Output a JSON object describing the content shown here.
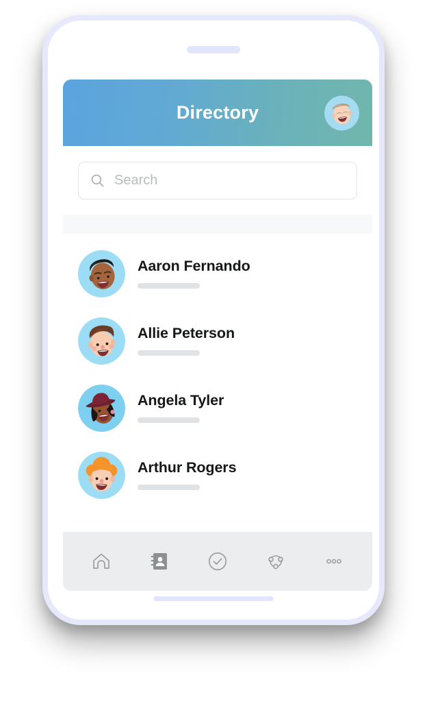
{
  "device": {
    "speaker_name": "speaker-grille",
    "home_indicator_name": "home-indicator",
    "frame_color": "#e6e8fb"
  },
  "header": {
    "title": "Directory",
    "gradient_from": "#5ba4de",
    "gradient_to": "#71b6ac",
    "avatar": {
      "name": "header-profile-avatar",
      "skin": "#f2d0b8",
      "hair": "#b49a82",
      "bg": "#a5dcf2"
    }
  },
  "search": {
    "placeholder": "Search",
    "value": "",
    "icon": "search-icon"
  },
  "contacts": [
    {
      "name": "Aaron Fernando",
      "avatar": {
        "skin": "#a4653c",
        "hair": "#1b1b1b",
        "bg": "#9ddcf5"
      }
    },
    {
      "name": "Allie Peterson",
      "avatar": {
        "skin": "#f7cdb2",
        "hair": "#6d3b24",
        "bg": "#9ddcf5"
      }
    },
    {
      "name": "Angela Tyler",
      "avatar": {
        "skin": "#97522f",
        "hair": "#181818",
        "bg": "#7ed0f0"
      }
    },
    {
      "name": "Arthur Rogers",
      "avatar": {
        "skin": "#f8cfb4",
        "hair": "#f5932c",
        "bg": "#9ddcf5"
      }
    }
  ],
  "bottom_nav": {
    "items": [
      {
        "icon": "home-icon",
        "active": false
      },
      {
        "icon": "contacts-book-icon",
        "active": true
      },
      {
        "icon": "check-circle-icon",
        "active": false
      },
      {
        "icon": "network-share-icon",
        "active": false
      },
      {
        "icon": "more-dots-icon",
        "active": false
      }
    ],
    "active_color": "#8c9093",
    "inactive_color": "#9a9ea1",
    "background": "#ebedee"
  }
}
